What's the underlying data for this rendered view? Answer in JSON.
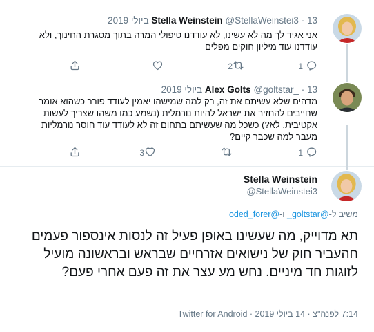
{
  "tweets": [
    {
      "name": "Stella Weinstein",
      "handle": "@StellaWeinstei3",
      "date": "13 ביולי 2019",
      "text": "אני אגיד לך מה לא עשינו, לא עודדנו טיפולי המרה בתוך מסגרת החינוך, ולא עודדנו עוד מיליון חוקים מפלים",
      "replies": "1",
      "retweets": "2",
      "likes": ""
    },
    {
      "name": "Alex Golts",
      "handle": "@goltstar_",
      "date": "13 ביולי 2019",
      "text": "מדהים שלא עשיתם את זה, רק למה שמישהו יאמין לעודד פורר כשהוא אומר שחייבים להחזיר את ישראל להיות נורמלית (נשמע כמו משהו שצריך לעשות אקטיבית, לא?) כשכל מה שעשיתם בתחום זה לא לעודד עוד חוסר נורמליות מעבר למה שכבר קיים?",
      "replies": "1",
      "retweets": "",
      "likes": "3"
    }
  ],
  "main_tweet": {
    "name": "Stella Weinstein",
    "handle": "@StellaWeinstei3",
    "reply_prefix": "משיב ל-",
    "reply_handle_1": "@goltstar_",
    "reply_joiner": " ו-",
    "reply_handle_2": "@oded_forer",
    "text": "תא מדוייק, מה שעשינו באופן פעיל זה לנסות אינספור פעמים חהעביר חוק של נישואים אזרחיים שבראש ובראשונה מועיל לזוגות חד מיניים. נחש מע עצר את זה פעם אחרי פעם?",
    "timestamp": "7:14 לפנה\"צ · 14 ביולי 2019 · Twitter for Android"
  },
  "icons": [
    "reply-icon",
    "retweet-icon",
    "like-icon",
    "share-icon"
  ],
  "colors": {
    "accent": "#1b95e0",
    "muted": "#657786",
    "border": "#e6ecf0"
  }
}
